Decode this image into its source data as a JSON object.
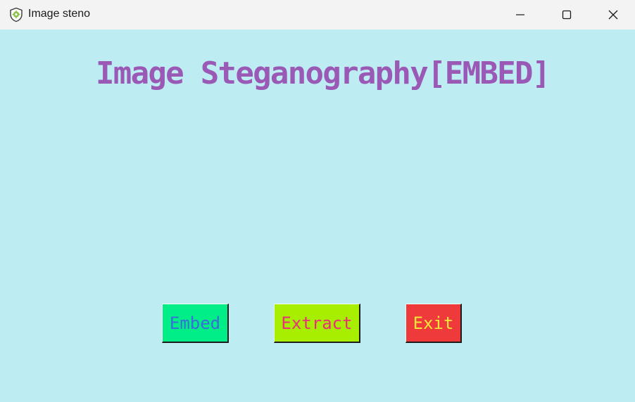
{
  "window": {
    "title": "Image steno",
    "icon": "shield-gear-icon",
    "controls": {
      "minimize_icon": "minimize-icon",
      "maximize_icon": "maximize-icon",
      "close_icon": "close-icon"
    }
  },
  "main": {
    "heading": "Image Steganography[EMBED]",
    "background_color": "#bdedf3",
    "heading_color": "#9b59b6",
    "buttons": [
      {
        "label": "Embed",
        "bg": "#00ee88",
        "fg": "#3b6fd8"
      },
      {
        "label": "Extract",
        "bg": "#a8ee00",
        "fg": "#e8307a"
      },
      {
        "label": "Exit",
        "bg": "#ee3a3a",
        "fg": "#f5e63a"
      }
    ]
  }
}
